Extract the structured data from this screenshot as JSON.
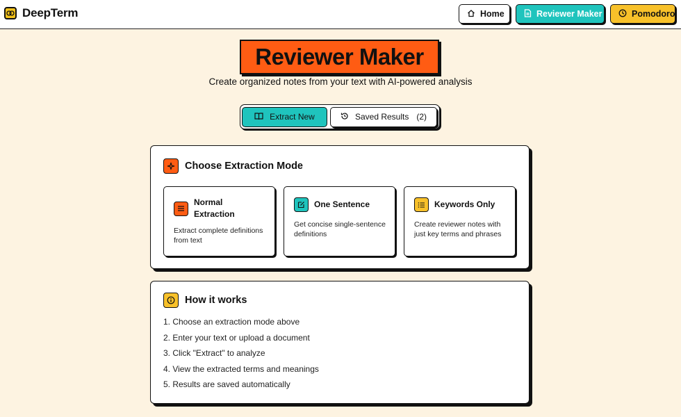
{
  "brand": {
    "name": "DeepTerm",
    "icon": "brain-icon",
    "accent": "#f4c21a"
  },
  "nav": [
    {
      "label": "Home",
      "icon": "home-icon",
      "color": "#ffffff"
    },
    {
      "label": "Reviewer Maker",
      "icon": "document-icon",
      "color": "#1fc4bd"
    },
    {
      "label": "Pomodoro",
      "icon": "clock-icon",
      "color": "#f8c12a"
    }
  ],
  "hero": {
    "title": "Reviewer Maker",
    "subtitle": "Create organized notes from your text with AI-powered analysis",
    "title_bg": "#ff5c13"
  },
  "tabs": {
    "extract_label": "Extract New",
    "saved_label": "Saved Results",
    "saved_count": "(2)"
  },
  "mode_card": {
    "title": "Choose Extraction Mode",
    "icon": "sparkle-icon",
    "modes": [
      {
        "title": "Normal Extraction",
        "desc": "Extract complete definitions from text",
        "icon": "lines-icon",
        "color": "#ff5c13"
      },
      {
        "title": "One Sentence",
        "desc": "Get concise single-sentence definitions",
        "icon": "edit-icon",
        "color": "#1fc4bd"
      },
      {
        "title": "Keywords Only",
        "desc": "Create reviewer notes with just key terms and phrases",
        "icon": "list-icon",
        "color": "#f8c12a"
      }
    ]
  },
  "how_card": {
    "title": "How it works",
    "icon": "info-icon",
    "steps": [
      "1. Choose an extraction mode above",
      "2. Enter your text or upload a document",
      "3. Click \"Extract\" to analyze",
      "4. View the extracted terms and meanings",
      "5. Results are saved automatically"
    ]
  }
}
